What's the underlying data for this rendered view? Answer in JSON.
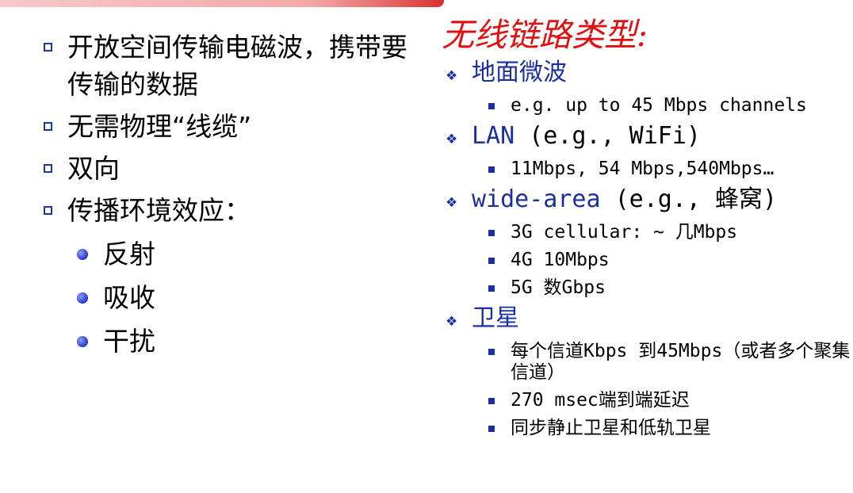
{
  "left_items": [
    {
      "text": "开放空间传输电磁波，携带要传输的数据"
    },
    {
      "text": "无需物理“线缆”"
    },
    {
      "text": "双向"
    },
    {
      "text": "传播环境效应："
    }
  ],
  "left_sub_items": [
    "反射",
    "吸收",
    "干扰"
  ],
  "right": {
    "title": "无线链路类型:",
    "groups": [
      {
        "label": "地面微波",
        "extra": "",
        "subs": [
          "e.g. up to 45 Mbps channels"
        ]
      },
      {
        "label": "LAN",
        "extra": " (e.g., WiFi)",
        "subs": [
          "11Mbps, 54 Mbps,540Mbps…"
        ]
      },
      {
        "label": "wide-area",
        "extra": " (e.g., 蜂窝)",
        "subs": [
          "3G cellular: ~ 几Mbps",
          "4G 10Mbps",
          "5G 数Gbps"
        ]
      },
      {
        "label": "卫星",
        "extra": "",
        "subs": [
          "每个信道Kbps 到45Mbps（或者多个聚集信道）",
          "270 msec端到端延迟",
          "同步静止卫星和低轨卫星"
        ]
      }
    ]
  },
  "colors": {
    "title": "#e01010",
    "accent": "#1a2fa0",
    "topbar": "#d83030"
  }
}
